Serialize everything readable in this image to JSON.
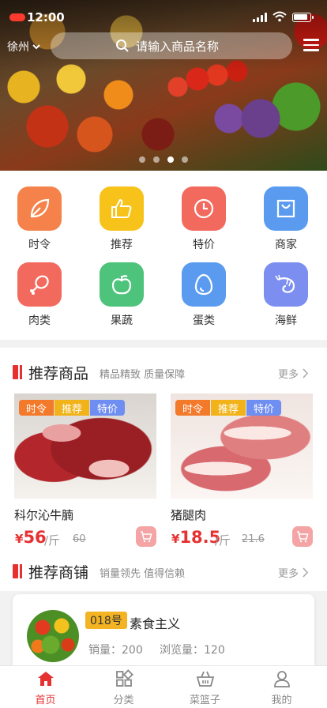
{
  "status_bar": {
    "time": "12:00"
  },
  "header": {
    "city": "徐州",
    "search_placeholder": "请输入商品名称"
  },
  "banner": {
    "slide_count": 4,
    "active_slide": 3
  },
  "categories": [
    {
      "label": "时令",
      "icon": "leaf-icon",
      "color": "#f5824a"
    },
    {
      "label": "推荐",
      "icon": "thumbs-up-icon",
      "color": "#f7c31a"
    },
    {
      "label": "特价",
      "icon": "clock-icon",
      "color": "#f26a5e"
    },
    {
      "label": "商家",
      "icon": "shopping-bag-icon",
      "color": "#5a9bf0"
    },
    {
      "label": "肉类",
      "icon": "drumstick-icon",
      "color": "#f26a5e"
    },
    {
      "label": "果蔬",
      "icon": "apple-icon",
      "color": "#4ec37b"
    },
    {
      "label": "蛋类",
      "icon": "egg-icon",
      "color": "#5a9bf0"
    },
    {
      "label": "海鲜",
      "icon": "shrimp-icon",
      "color": "#7c8ef0"
    }
  ],
  "recommended_products": {
    "title": "推荐商品",
    "subtitle": "精品精致 质量保障",
    "more": "更多",
    "items": [
      {
        "name": "科尔沁牛腩",
        "tags": [
          "时令",
          "推荐",
          "特价"
        ],
        "currency": "¥",
        "price": "56",
        "unit": "/斤",
        "old_price": "60"
      },
      {
        "name": "猪腿肉",
        "tags": [
          "时令",
          "推荐",
          "特价"
        ],
        "currency": "¥",
        "price": "18.5",
        "unit": "/斤",
        "old_price": "21.6"
      }
    ]
  },
  "recommended_shops": {
    "title": "推荐商铺",
    "subtitle": "销量领先 值得信赖",
    "more": "更多",
    "items": [
      {
        "number": "018号",
        "name": "素食主义",
        "sales": "销量：200",
        "views": "浏览量：120"
      }
    ]
  },
  "tabbar": {
    "active": "home",
    "accent_color": "#e63131",
    "tabs": [
      {
        "id": "home",
        "label": "首页",
        "icon": "home-icon"
      },
      {
        "id": "category",
        "label": "分类",
        "icon": "grid-icon"
      },
      {
        "id": "basket",
        "label": "菜篮子",
        "icon": "basket-icon"
      },
      {
        "id": "mine",
        "label": "我的",
        "icon": "person-icon"
      }
    ]
  }
}
